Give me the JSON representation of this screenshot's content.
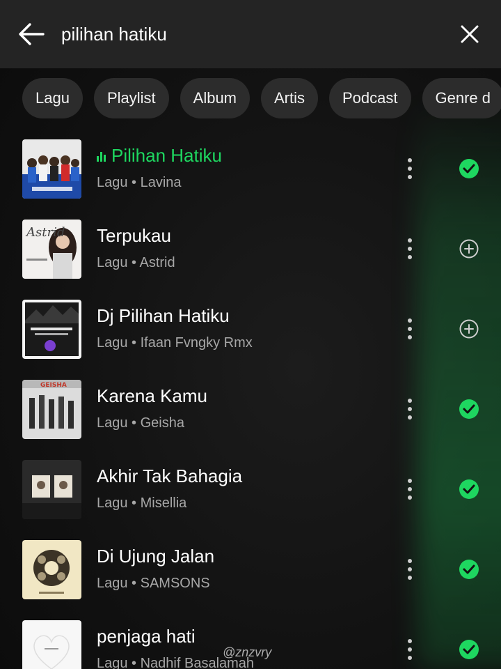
{
  "search": {
    "query": "pilihan hatiku",
    "back_icon": "arrow-left-icon",
    "clear_icon": "close-icon"
  },
  "filters": [
    "Lagu",
    "Playlist",
    "Album",
    "Artis",
    "Podcast",
    "Genre d"
  ],
  "results": [
    {
      "title": "Pilihan Hatiku",
      "subtitle": "Lagu • Lavina",
      "playing": true,
      "saved": true
    },
    {
      "title": "Terpukau",
      "subtitle": "Lagu • Astrid",
      "playing": false,
      "saved": false
    },
    {
      "title": "Dj Pilihan Hatiku",
      "subtitle": "Lagu • Ifaan Fvngky Rmx",
      "playing": false,
      "saved": false
    },
    {
      "title": "Karena Kamu",
      "subtitle": "Lagu • Geisha",
      "playing": false,
      "saved": true
    },
    {
      "title": "Akhir Tak Bahagia",
      "subtitle": "Lagu • Misellia",
      "playing": false,
      "saved": true
    },
    {
      "title": "Di Ujung Jalan",
      "subtitle": "Lagu • SAMSONS",
      "playing": false,
      "saved": true
    },
    {
      "title": "penjaga hati",
      "subtitle": "Lagu • Nadhif Basalamah",
      "playing": false,
      "saved": true
    }
  ],
  "watermark": "@znzvry",
  "colors": {
    "accent": "#1ed760",
    "background": "#121212",
    "header": "#242424",
    "chip": "#2c2c2c",
    "subtitle": "#a7a7a7"
  }
}
